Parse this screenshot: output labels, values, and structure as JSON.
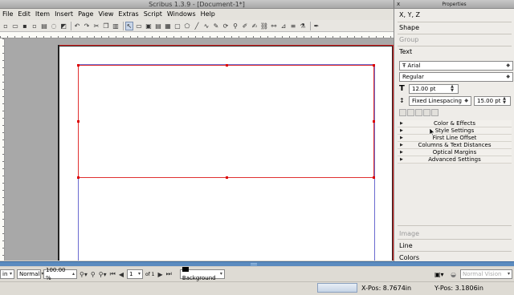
{
  "window": {
    "title": "Scribus 1.3.9 - [Document-1*]"
  },
  "properties_panel": {
    "title": "Properties",
    "close_glyph": "x",
    "tabs": [
      "X, Y, Z",
      "Shape",
      "Group",
      "Text"
    ],
    "bottom_tabs": [
      "Image",
      "Line",
      "Colors"
    ],
    "font_family": "Arial",
    "font_prefix_icon": "T-icon",
    "font_style": "Regular",
    "font_size": "12.00 pt",
    "line_spacing_mode": "Fixed Linespacing",
    "line_spacing_value": "15.00 pt",
    "sections": [
      "Color & Effects",
      "Style Settings",
      "First Line Offset",
      "Columns & Text Distances",
      "Optical Margins",
      "Advanced Settings"
    ]
  },
  "menubar": {
    "items": [
      "File",
      "Edit",
      "Item",
      "Insert",
      "Page",
      "View",
      "Extras",
      "Script",
      "Windows",
      "Help"
    ]
  },
  "statusbar": {
    "unit": "in",
    "mode": "Normal",
    "zoom": "100.00 %",
    "page_number": "1",
    "page_of": "of 1",
    "layer": "Background",
    "view_mode": "Normal Vision",
    "x_pos": "X-Pos: 8.7674in",
    "y_pos": "Y-Pos: 3.1806in"
  },
  "colors": {
    "frame_border": "#e03030",
    "margin_guide": "#6b6bd0",
    "splitter": "#5b8bbf"
  }
}
